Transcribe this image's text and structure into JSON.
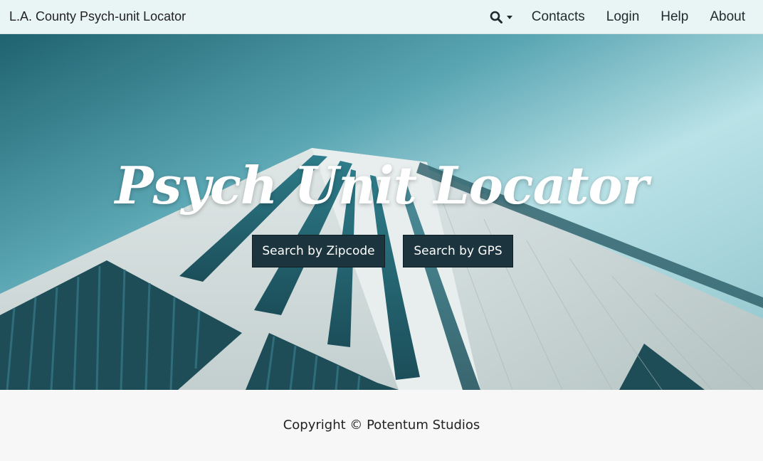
{
  "navbar": {
    "brand": "L.A. County Psych-unit Locator",
    "search_icon": "search-icon",
    "items": [
      {
        "label": "Contacts"
      },
      {
        "label": "Login"
      },
      {
        "label": "Help"
      },
      {
        "label": "About"
      }
    ]
  },
  "hero": {
    "title": "Psych Unit Locator",
    "buttons": {
      "zipcode": "Search by Zipcode",
      "gps": "Search by GPS"
    }
  },
  "footer": {
    "copyright": "Copyright © Potentum Studios"
  },
  "colors": {
    "navbar_bg": "#e9f5f4",
    "button_bg": "#1b343d",
    "footer_bg": "#f7f7f7"
  }
}
